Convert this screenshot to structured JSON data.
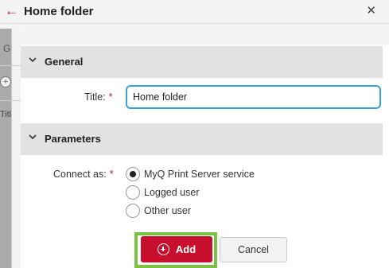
{
  "background": {
    "partial_label_top": "G",
    "partial_label_bottom": "Titl"
  },
  "header": {
    "title": "Home folder",
    "back_icon": "arrow-left-icon",
    "close_icon": "close-icon"
  },
  "sections": {
    "general": {
      "label": "General"
    },
    "parameters": {
      "label": "Parameters"
    }
  },
  "fields": {
    "title": {
      "label": "Title:",
      "required_mark": "*",
      "value": "Home folder"
    },
    "connect_as": {
      "label": "Connect as:",
      "required_mark": "*",
      "options": [
        {
          "label": "MyQ Print Server service",
          "checked": true
        },
        {
          "label": "Logged user",
          "checked": false
        },
        {
          "label": "Other user",
          "checked": false
        }
      ]
    }
  },
  "buttons": {
    "add": "Add",
    "cancel": "Cancel"
  },
  "colors": {
    "accent_red": "#c8102e",
    "focus_blue": "#36a2d6",
    "highlight_green": "#7bc142"
  }
}
